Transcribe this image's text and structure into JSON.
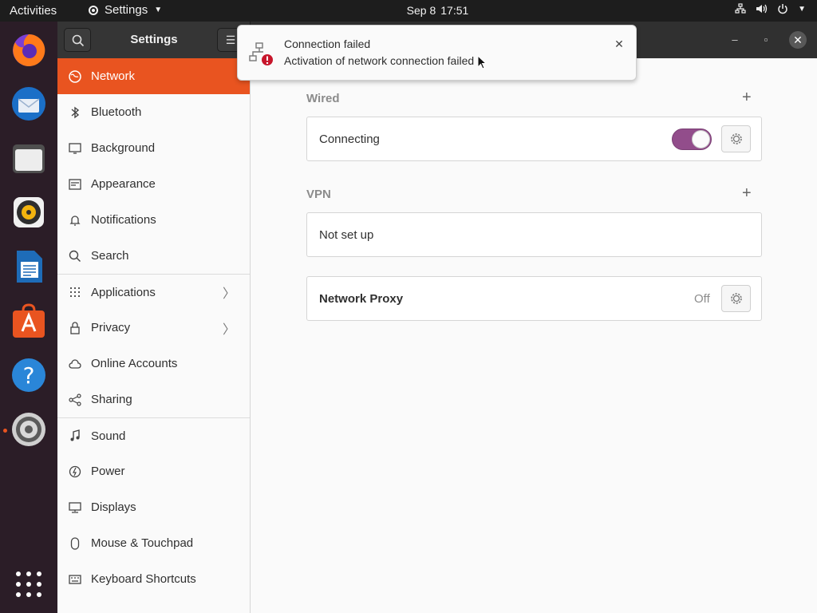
{
  "topbar": {
    "activities": "Activities",
    "app_menu": "Settings",
    "date": "Sep 8",
    "time": "17:51"
  },
  "dock": {
    "apps": [
      "firefox-icon",
      "thunderbird-icon",
      "files-icon",
      "rhythmbox-icon",
      "writer-icon",
      "software-icon",
      "help-icon",
      "settings-icon"
    ],
    "running_app": "settings-icon"
  },
  "window": {
    "title": "Settings"
  },
  "sidebar": {
    "items": [
      {
        "label": "Network",
        "icon": "network-icon",
        "active": true
      },
      {
        "label": "Bluetooth",
        "icon": "bluetooth-icon"
      },
      {
        "label": "Background",
        "icon": "background-icon"
      },
      {
        "label": "Appearance",
        "icon": "appearance-icon"
      },
      {
        "label": "Notifications",
        "icon": "bell-icon"
      },
      {
        "label": "Search",
        "icon": "search-icon"
      },
      {
        "label": "Applications",
        "icon": "applications-icon",
        "chevron": true
      },
      {
        "label": "Privacy",
        "icon": "lock-icon",
        "chevron": true
      },
      {
        "label": "Online Accounts",
        "icon": "cloud-icon"
      },
      {
        "label": "Sharing",
        "icon": "share-icon"
      },
      {
        "label": "Sound",
        "icon": "music-note-icon"
      },
      {
        "label": "Power",
        "icon": "power-icon"
      },
      {
        "label": "Displays",
        "icon": "display-icon"
      },
      {
        "label": "Mouse & Touchpad",
        "icon": "mouse-icon"
      },
      {
        "label": "Keyboard Shortcuts",
        "icon": "keyboard-icon"
      }
    ]
  },
  "content": {
    "wired": {
      "title": "Wired",
      "connection_label": "Connecting",
      "toggle_on": true
    },
    "vpn": {
      "title": "VPN",
      "status": "Not set up"
    },
    "proxy": {
      "label": "Network Proxy",
      "status": "Off"
    }
  },
  "notification": {
    "title": "Connection failed",
    "body": "Activation of network connection failed"
  },
  "colors": {
    "accent": "#e95420",
    "toggle": "#924d8b",
    "error": "#c7162b"
  }
}
